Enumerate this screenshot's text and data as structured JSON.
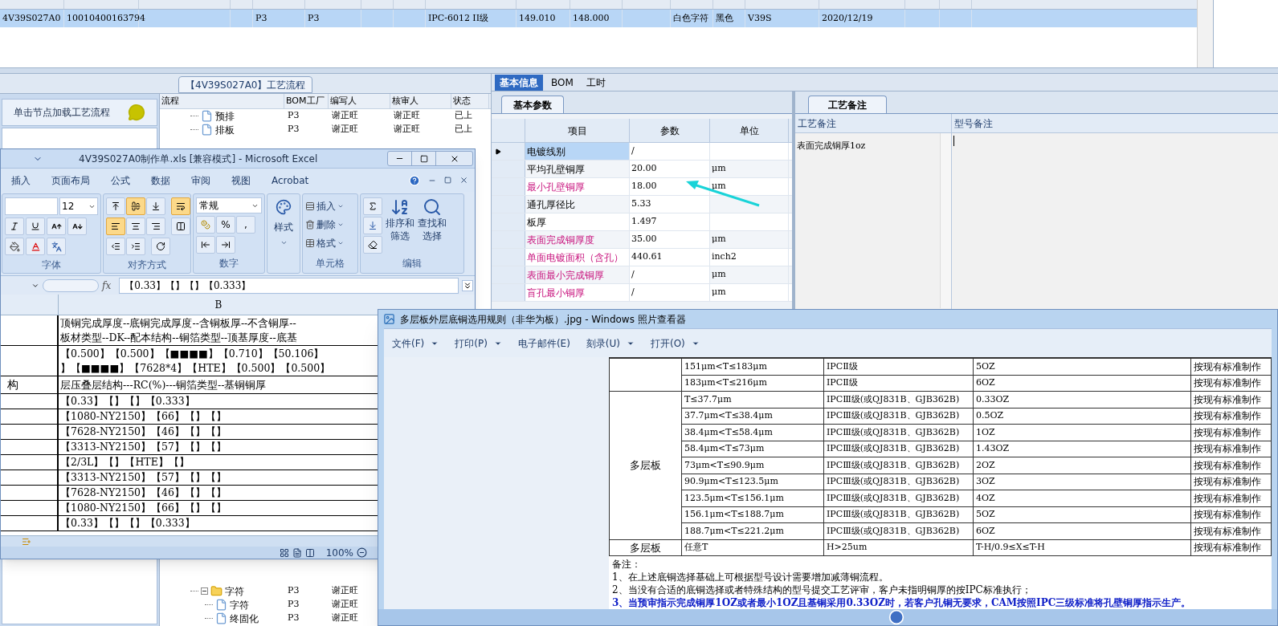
{
  "record_grid": {
    "row": {
      "selected": true,
      "cells": [
        {
          "text": "4V39S027A0"
        },
        {
          "text": "10010400163794"
        },
        {},
        {},
        {
          "text": "P3"
        },
        {
          "text": "P3"
        },
        {},
        {},
        {
          "text": "IPC-6012 II级"
        },
        {
          "text": "149.010"
        },
        {
          "text": "148.000"
        },
        {},
        {
          "text": "白色字符"
        },
        {
          "text": "黑色"
        },
        {
          "text": "V39S"
        },
        {
          "text": "2020/12/19"
        },
        {},
        {}
      ]
    }
  },
  "process_panel": {
    "title": "【4V39S027A0】工艺流程",
    "hint": "单击节点加载工艺流程",
    "columns": [
      "流程",
      "BOM工厂",
      "编写人",
      "核审人",
      "状态"
    ],
    "top_rows": [
      {
        "kind": "file",
        "name": "预排",
        "factory": "P3",
        "writer": "谢正旺",
        "reviewer": "谢正旺",
        "status": "已上"
      },
      {
        "kind": "file",
        "name": "排板",
        "factory": "P3",
        "writer": "谢正旺",
        "reviewer": "谢正旺",
        "status": "已上"
      }
    ],
    "bottom_rows": [
      {
        "kind": "folder",
        "name": "字符",
        "expanded": true,
        "factory": "P3",
        "writer": "谢正旺",
        "children": [
          {
            "kind": "file",
            "name": "字符",
            "factory": "P3",
            "writer": "谢正旺"
          },
          {
            "kind": "file",
            "name": "终固化",
            "factory": "P3",
            "writer": "谢正旺"
          }
        ]
      }
    ]
  },
  "right_panel": {
    "tabs": [
      {
        "label": "基本信息",
        "selected": true
      },
      {
        "label": "BOM",
        "selected": false
      },
      {
        "label": "工时",
        "selected": false
      }
    ],
    "params": {
      "tab": "基本参数",
      "columns": [
        "项目",
        "参数",
        "单位"
      ],
      "rows": [
        {
          "item": "电镀线别",
          "value": "/",
          "current": true,
          "emphasized": false
        },
        {
          "item": "平均孔壁铜厚",
          "value": "20.00",
          "unit": "μm",
          "current": false,
          "emphasized": false
        },
        {
          "item": "最小孔壁铜厚",
          "value": "18.00",
          "unit": "μm",
          "current": false,
          "emphasized": true
        },
        {
          "item": "通孔厚径比",
          "value": "5.33",
          "current": false,
          "emphasized": false
        },
        {
          "item": "板厚",
          "value": "1.497",
          "current": false,
          "emphasized": false
        },
        {
          "item": "表面完成铜厚度",
          "value": "35.00",
          "unit": "μm",
          "current": false,
          "emphasized": true
        },
        {
          "item": "单面电镀面积（含孔）",
          "value": "440.61",
          "unit": "inch2",
          "current": false,
          "emphasized": true
        },
        {
          "item": "表面最小完成铜厚",
          "value": "/",
          "unit": "μm",
          "current": false,
          "emphasized": true
        },
        {
          "item": "盲孔最小铜厚",
          "value": "/",
          "unit": "μm",
          "current": false,
          "emphasized": true
        }
      ]
    },
    "notes": {
      "tab": "工艺备注",
      "columns": [
        "工艺备注",
        "型号备注"
      ],
      "process_note": "表面完成铜厚1oz"
    }
  },
  "excel": {
    "title": "4V39S027A0制作单.xls  [兼容模式] - Microsoft Excel",
    "tabs": [
      "插入",
      "页面布局",
      "公式",
      "数据",
      "审阅",
      "视图",
      "Acrobat"
    ],
    "ribbon": {
      "font_size": "12",
      "font_group": "字体",
      "vertical_align": [
        {
          "kind": "top",
          "selected": false
        },
        {
          "kind": "middle",
          "selected": true
        },
        {
          "kind": "bottom",
          "selected": false
        }
      ],
      "horizontal_align": [
        {
          "kind": "left",
          "selected": true
        },
        {
          "kind": "center",
          "selected": false
        },
        {
          "kind": "right",
          "selected": false
        }
      ],
      "wrap_selected": true,
      "align_group": "对齐方式",
      "number_format": "常规",
      "number_buttons": [
        "%",
        ","
      ],
      "number_group": "数字",
      "styles_button": "样式",
      "cell_buttons": [
        "插入",
        "删除",
        "格式"
      ],
      "cells_group": "单元格",
      "edit_buttons": [
        [
          "排序和",
          "筛选"
        ],
        [
          "查找和",
          "选择"
        ]
      ],
      "edit_group": "编辑"
    },
    "function_label": "fx",
    "formula": "【0.33】【】【】【0.333】",
    "column": "B",
    "rows": [
      {
        "b": [
          "顶铜完成厚度--底铜完成厚度--含铜板厚--不含铜厚--",
          "板材类型--DK--配本结构--铜箔类型--顶基厚度--底基"
        ]
      },
      {
        "b": [
          "【0.500】【0.500】【■■■■】【0.710】【50.106】",
          "】【■■■■】【7628*4】【HTE】【0.500】【0.500】"
        ]
      },
      {
        "a": "构",
        "b": [
          "层压叠层结构---RC(%)---铜箔类型--基铜铜厚"
        ]
      },
      {
        "b": [
          "【0.33】【】【】【0.333】"
        ]
      },
      {
        "b": [
          "【1080-NY2150】【66】【】【】"
        ]
      },
      {
        "b": [
          "【7628-NY2150】【46】【】【】"
        ]
      },
      {
        "b": [
          "【3313-NY2150】【57】【】【】"
        ]
      },
      {
        "b": [
          "【2/3L】【】【HTE】【】"
        ]
      },
      {
        "b": [
          "【3313-NY2150】【57】【】【】"
        ]
      },
      {
        "b": [
          "【7628-NY2150】【46】【】【】"
        ]
      },
      {
        "b": [
          "【1080-NY2150】【66】【】【】"
        ]
      },
      {
        "b": [
          "【0.33】【】【】【0.333】"
        ]
      }
    ],
    "zoom": "100%"
  },
  "photo_viewer": {
    "title": "多层板外层底铜选用规则（非华为板）.jpg - Windows 照片查看器",
    "menu": [
      {
        "label": "文件(F)",
        "dropdown": true
      },
      {
        "label": "打印(P)",
        "dropdown": true
      },
      {
        "label": "电子邮件(E)",
        "dropdown": false
      },
      {
        "label": "刻录(U)",
        "dropdown": true
      },
      {
        "label": "打开(O)",
        "dropdown": true
      }
    ],
    "table": {
      "groups": [
        {
          "rows": [
            {
              "range": "151μm<T≤183μm",
              "grade": "IPCⅡ级",
              "copper": "5OZ",
              "method": "按现有标准制作"
            },
            {
              "range": "183μm<T≤216μm",
              "grade": "IPCⅡ级",
              "copper": "6OZ",
              "method": "按现有标准制作"
            }
          ]
        },
        {
          "category": "多层板",
          "rows": [
            {
              "range": "T≤37.7μm",
              "grade": "IPCⅢ级(或QJ831B、GJB362B)",
              "copper": "0.33OZ",
              "method": "按现有标准制作"
            },
            {
              "range": "37.7μm<T≤38.4μm",
              "grade": "IPCⅢ级(或QJ831B、GJB362B)",
              "copper": "0.5OZ",
              "method": "按现有标准制作"
            },
            {
              "range": "38.4μm<T≤58.4μm",
              "grade": "IPCⅢ级(或QJ831B、GJB362B)",
              "copper": "1OZ",
              "method": "按现有标准制作"
            },
            {
              "range": "58.4μm<T≤73μm",
              "grade": "IPCⅢ级(或QJ831B、GJB362B)",
              "copper": "1.43OZ",
              "method": "按现有标准制作"
            },
            {
              "range": "73μm<T≤90.9μm",
              "grade": "IPCⅢ级(或QJ831B、GJB362B)",
              "copper": "2OZ",
              "method": "按现有标准制作"
            },
            {
              "range": "90.9μm<T≤123.5μm",
              "grade": "IPCⅢ级(或QJ831B、GJB362B)",
              "copper": "3OZ",
              "method": "按现有标准制作"
            },
            {
              "range": "123.5μm<T≤156.1μm",
              "grade": "IPCⅢ级(或QJ831B、GJB362B)",
              "copper": "4OZ",
              "method": "按现有标准制作"
            },
            {
              "range": "156.1μm<T≤188.7μm",
              "grade": "IPCⅢ级(或QJ831B、GJB362B)",
              "copper": "5OZ",
              "method": "按现有标准制作"
            },
            {
              "range": "188.7μm<T≤221.2μm",
              "grade": "IPCⅢ级(或QJ831B、GJB362B)",
              "copper": "6OZ",
              "method": "按现有标准制作"
            }
          ]
        },
        {
          "category": "多层板",
          "rows": [
            {
              "range": "任意T",
              "grade": "H>25um",
              "copper": "T-H/0.9≤X≤T-H",
              "method": "按现有标准制作"
            }
          ]
        }
      ]
    },
    "notes": [
      {
        "text": "备注：",
        "emphasized": false
      },
      {
        "text": "1、在上述底铜选择基础上可根据型号设计需要增加减薄铜流程。",
        "emphasized": false
      },
      {
        "text": "2、当没有合适的底铜选择或者特殊结构的型号提交工艺评审，客户未指明铜厚的按IPC标准执行；",
        "emphasized": false
      },
      {
        "text": "3、当预审指示完成铜厚1OZ或者最小1OZ且基铜采用0.33OZ时，若客户孔铜无要求，CAM按照IPC三级标准将孔壁铜厚指示生产。",
        "emphasized": true
      }
    ]
  }
}
